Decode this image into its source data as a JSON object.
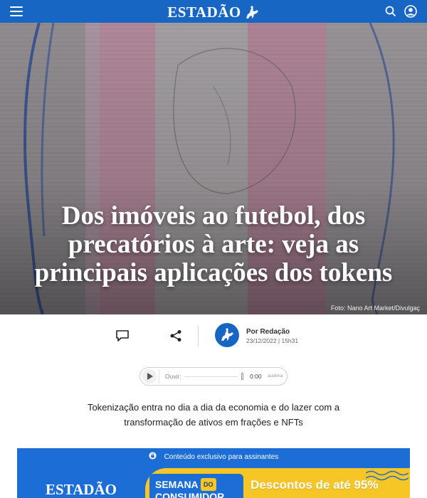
{
  "header": {
    "brand": "ESTADÃO",
    "bg_color": "#1766c4",
    "icons": [
      "menu-icon",
      "search-icon",
      "user-icon"
    ]
  },
  "article": {
    "title": "Dos imóveis ao futebol, dos precatórios à arte: veja as principais aplicações dos tokens",
    "photo_credit": "Foto: Nano Art Market/Divulgaç",
    "author": "Por Redação",
    "date": "23/12/2022 | 15h31",
    "subtitle": "Tokenização entra no dia a dia da economia e do lazer com a transformação de ativos em frações e NFTs"
  },
  "audio": {
    "label": "Ouvir:",
    "time": "0:00",
    "brand": "audima"
  },
  "paywall": {
    "notice": "Conteúdo exclusivo para assinantes",
    "logo": "ESTADÃO",
    "campaign_line1": "SEMANA",
    "campaign_do": "DO",
    "campaign_line2": "CONSUMIDOR",
    "offer": "Descontos de até 95%",
    "accent_color": "#f5c625",
    "bg_color": "#1d6dd6"
  }
}
